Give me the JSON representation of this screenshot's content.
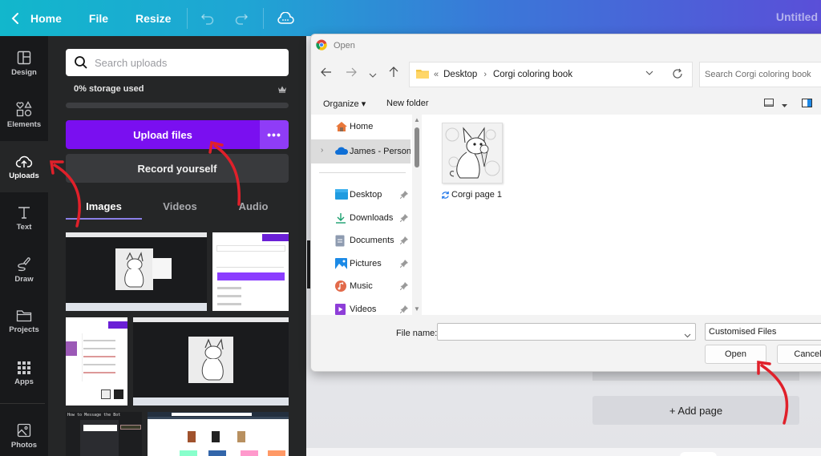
{
  "topbar": {
    "home": "Home",
    "file": "File",
    "resize": "Resize",
    "title": "Untitled"
  },
  "leftnav": {
    "items": [
      {
        "label": "Design",
        "icon": "layout-icon"
      },
      {
        "label": "Elements",
        "icon": "shapes-icon"
      },
      {
        "label": "Uploads",
        "icon": "cloud-upload-icon",
        "active": true
      },
      {
        "label": "Text",
        "icon": "text-icon"
      },
      {
        "label": "Draw",
        "icon": "draw-icon"
      },
      {
        "label": "Projects",
        "icon": "folder-icon"
      },
      {
        "label": "Apps",
        "icon": "apps-grid-icon"
      },
      {
        "label": "Photos",
        "icon": "photo-icon"
      }
    ]
  },
  "panel": {
    "search_placeholder": "Search uploads",
    "storage_text": "0% storage used",
    "storage_percent": 0,
    "upload_label": "Upload files",
    "more_label": "•••",
    "record_label": "Record yourself",
    "tabs": [
      {
        "label": "Images",
        "active": true
      },
      {
        "label": "Videos"
      },
      {
        "label": "Audio"
      }
    ],
    "thumb_caption": "How to Message the Bot"
  },
  "canvas": {
    "add_page": "+ Add page"
  },
  "dialog": {
    "title": "Open",
    "breadcrumb_prefix": "«",
    "breadcrumb": [
      "Desktop",
      "Corgi coloring book"
    ],
    "search_placeholder": "Search Corgi coloring book",
    "organize": "Organize ▾",
    "new_folder": "New folder",
    "nav_items": [
      {
        "label": "Home",
        "icon": "home-icon"
      },
      {
        "label": "James - Personal",
        "icon": "onedrive-cloud-icon",
        "selected": true,
        "expandable": true
      },
      {
        "label": "Desktop",
        "icon": "desktop-icon",
        "pinned": true
      },
      {
        "label": "Downloads",
        "icon": "download-icon",
        "pinned": true
      },
      {
        "label": "Documents",
        "icon": "document-icon",
        "pinned": true
      },
      {
        "label": "Pictures",
        "icon": "pictures-icon",
        "pinned": true
      },
      {
        "label": "Music",
        "icon": "music-icon",
        "pinned": true
      },
      {
        "label": "Videos",
        "icon": "videos-icon",
        "pinned": true
      }
    ],
    "files": [
      {
        "name": "Corgi page 1",
        "status": "sync-icon"
      }
    ],
    "file_name_label": "File name:",
    "file_name_value": "",
    "filter": "Customised Files",
    "open": "Open",
    "cancel": "Cancel"
  },
  "colors": {
    "accent_purple": "#7a0ff0",
    "annotation_red": "#e0202a"
  }
}
